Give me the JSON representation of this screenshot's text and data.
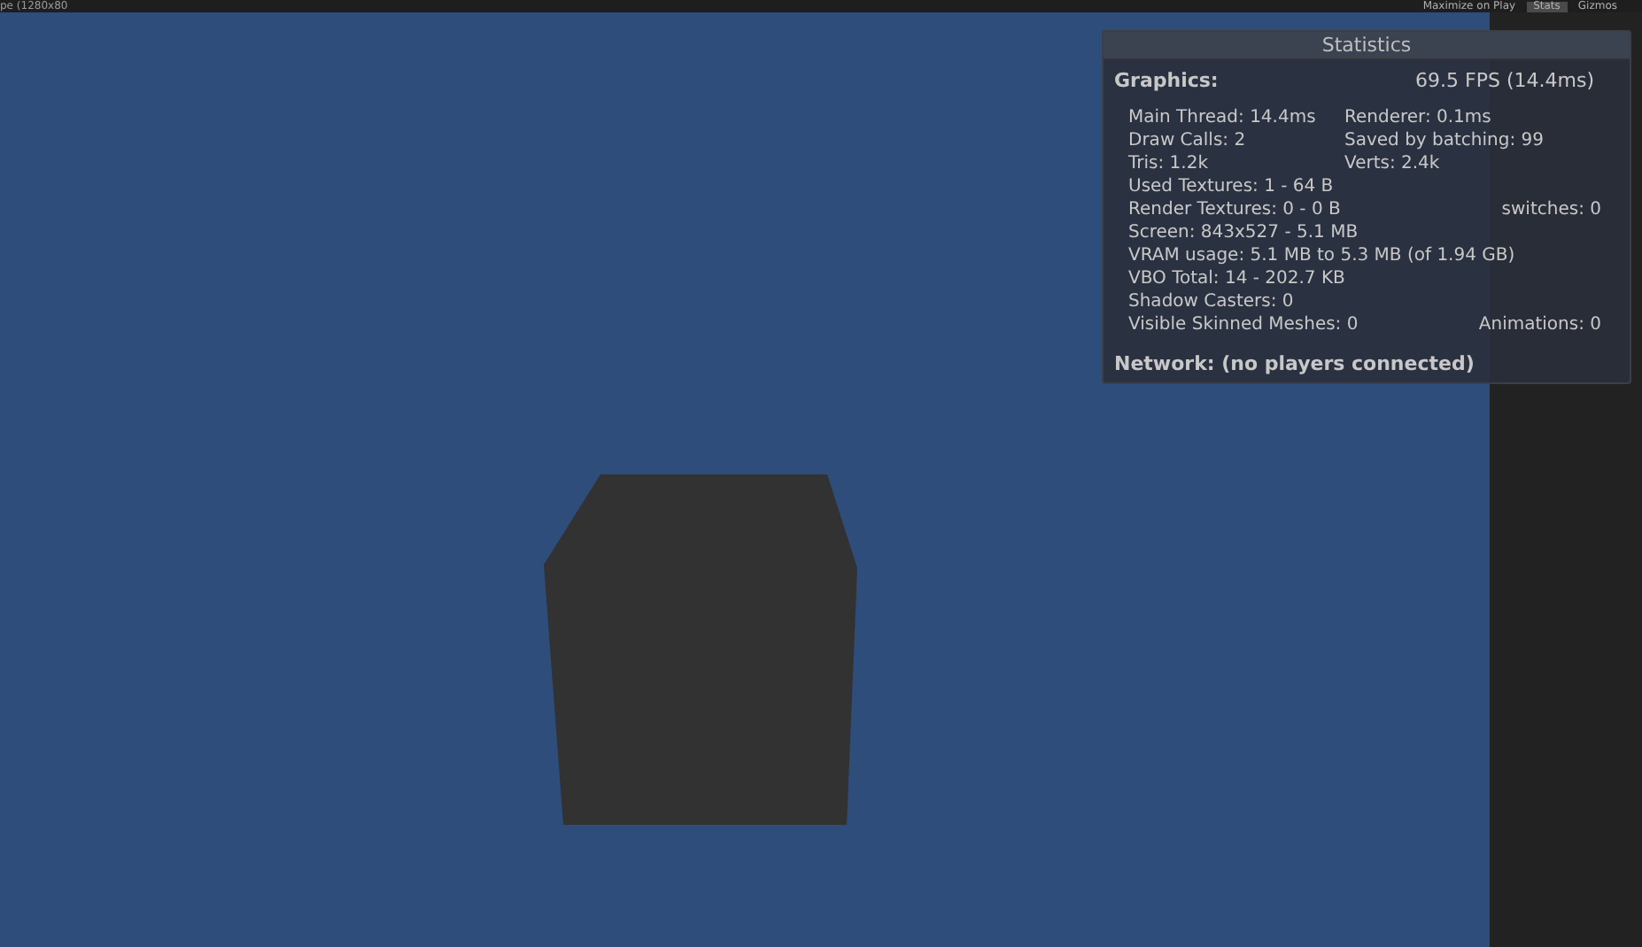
{
  "toolbar": {
    "left_label": "pe (1280x80",
    "buttons": [
      {
        "label": "Maximize on Play",
        "selected": false
      },
      {
        "label": "Stats",
        "selected": true
      },
      {
        "label": "Gizmos",
        "selected": false
      }
    ]
  },
  "statistics": {
    "title": "Statistics",
    "graphics_label": "Graphics:",
    "fps": "69.5 FPS (14.4ms)",
    "lines": [
      {
        "kind": "pair",
        "cells": [
          "Main Thread: 14.4ms",
          "Renderer: 0.1ms"
        ]
      },
      {
        "kind": "pair",
        "cells": [
          "Draw Calls: 2",
          "Saved by batching: 99"
        ]
      },
      {
        "kind": "pair",
        "cells": [
          "Tris: 1.2k",
          "Verts: 2.4k"
        ]
      },
      {
        "cells": [
          "Used Textures: 1 - 64 B"
        ]
      },
      {
        "kind": "split",
        "cells": [
          "Render Textures: 0 - 0 B",
          "switches: 0"
        ]
      },
      {
        "cells": [
          "Screen: 843x527 - 5.1 MB"
        ]
      },
      {
        "cells": [
          "VRAM usage: 5.1 MB to 5.3 MB (of 1.94 GB)"
        ]
      },
      {
        "cells": [
          "VBO Total: 14 - 202.7 KB"
        ]
      },
      {
        "cells": [
          "Shadow Casters: 0"
        ]
      },
      {
        "kind": "split",
        "cells": [
          "Visible Skinned Meshes: 0",
          "Animations: 0"
        ]
      }
    ],
    "network": "Network: (no players connected)"
  }
}
